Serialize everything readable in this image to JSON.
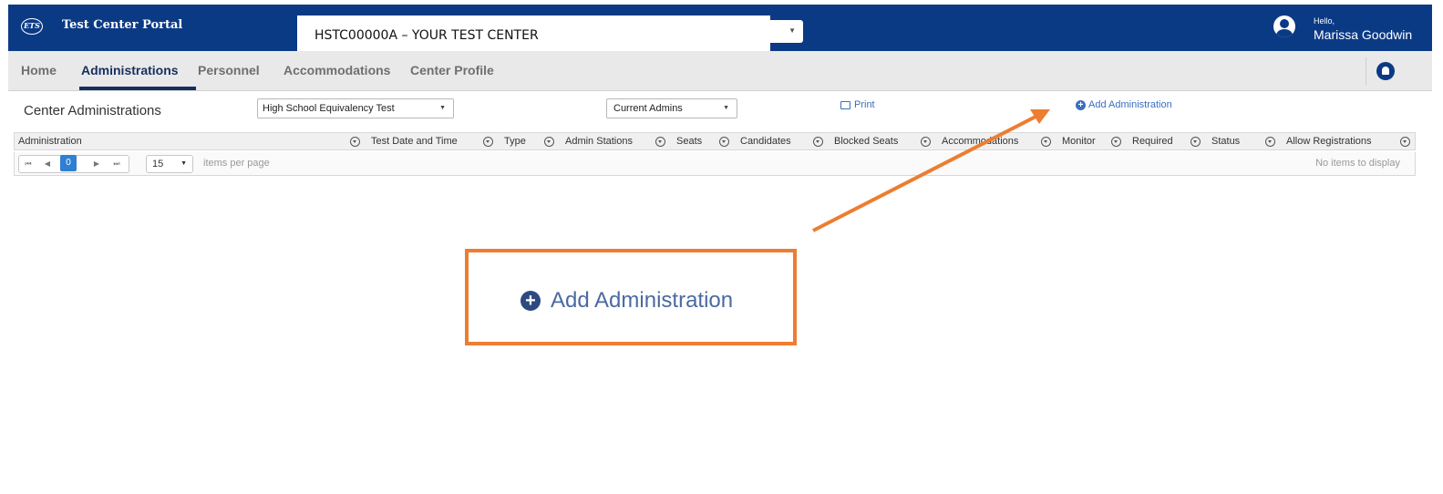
{
  "header": {
    "logo_text": "ETS",
    "portal_title": "Test Center Portal",
    "center_selected": "HSTC00000A – YOUR TEST CENTER",
    "greeting": "Hello,",
    "user_name": "Marissa Goodwin"
  },
  "nav": {
    "items": [
      {
        "label": "Home",
        "active": false
      },
      {
        "label": "Administrations",
        "active": true
      },
      {
        "label": "Personnel",
        "active": false
      },
      {
        "label": "Accommodations",
        "active": false
      },
      {
        "label": "Center Profile",
        "active": false
      }
    ],
    "notification_icon": "bell-icon"
  },
  "filters": {
    "section_title": "Center Administrations",
    "test_type": "High School Equivalency Test",
    "admin_scope": "Current Admins",
    "print_label": "Print",
    "add_admin_label": "Add Administration"
  },
  "grid": {
    "columns": [
      "Administration",
      "Test Date and Time",
      "Type",
      "Admin Stations",
      "Seats",
      "Candidates",
      "Blocked Seats",
      "Accommodations",
      "Monitor",
      "Required",
      "Status",
      "Allow Registrations"
    ],
    "pager": {
      "current_page": "0",
      "page_size": "15",
      "page_size_label": "items per page",
      "empty_message": "No items to display"
    }
  },
  "callout": {
    "label": "Add Administration",
    "color": "#ed7d31"
  },
  "colors": {
    "brand": "#0b3a85",
    "link": "#3a6fc0",
    "pager_active": "#2f7fd3"
  }
}
